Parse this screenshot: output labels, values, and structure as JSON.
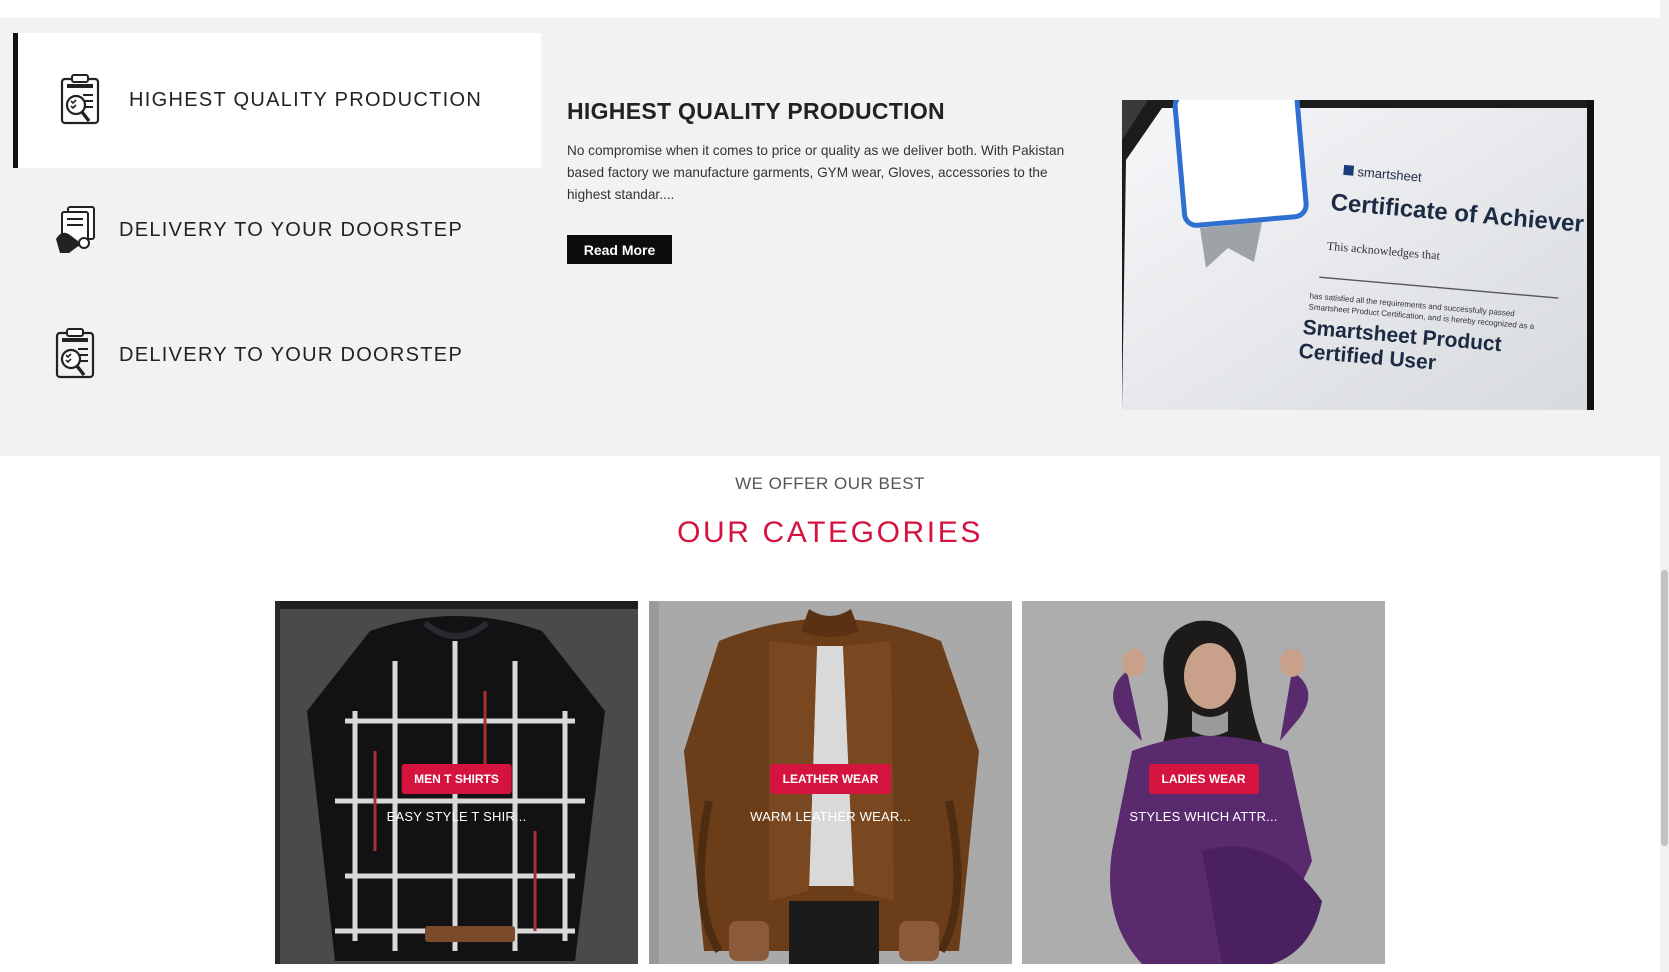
{
  "features": {
    "tabs": [
      {
        "label": "HIGHEST QUALITY PRODUCTION",
        "icon": "compliance-clipboard-icon",
        "active": true
      },
      {
        "label": "DELIVERY TO YOUR DOORSTEP",
        "icon": "delivery-documents-icon",
        "active": false
      },
      {
        "label": "DELIVERY TO YOUR DOORSTEP",
        "icon": "compliance-clipboard-icon",
        "active": false
      }
    ],
    "detail": {
      "title": "HIGHEST QUALITY PRODUCTION",
      "text": "No compromise when it comes to price or quality as we deliver both. With Pakistan based factory we manufacture garments, GYM wear, Gloves, accessories to the highest standar....",
      "read_more_label": "Read More"
    },
    "certificate": {
      "brand": "smartsheet",
      "heading": "Certificate of Achiever",
      "acknowledge": "This acknowledges that",
      "fine_print_1": "has satisfied all the requirements and successfully passed",
      "fine_print_2": "Smartsheet Product Certification, and is hereby recognized as a",
      "title_line_1": "Smartsheet Product",
      "title_line_2": "Certified User"
    }
  },
  "categories_section": {
    "eyebrow": "WE OFFER OUR BEST",
    "title": "OUR CATEGORIES",
    "items": [
      {
        "badge": "MEN T SHIRTS",
        "subtitle": "EASY STYLE T SHIR..."
      },
      {
        "badge": "LEATHER WEAR",
        "subtitle": "WARM LEATHER WEAR..."
      },
      {
        "badge": "LADIES WEAR",
        "subtitle": "STYLES WHICH ATTR..."
      }
    ]
  },
  "colors": {
    "accent": "#d4133e",
    "section_bg": "#f2f2f2",
    "button_bg": "#0d0d0d"
  }
}
